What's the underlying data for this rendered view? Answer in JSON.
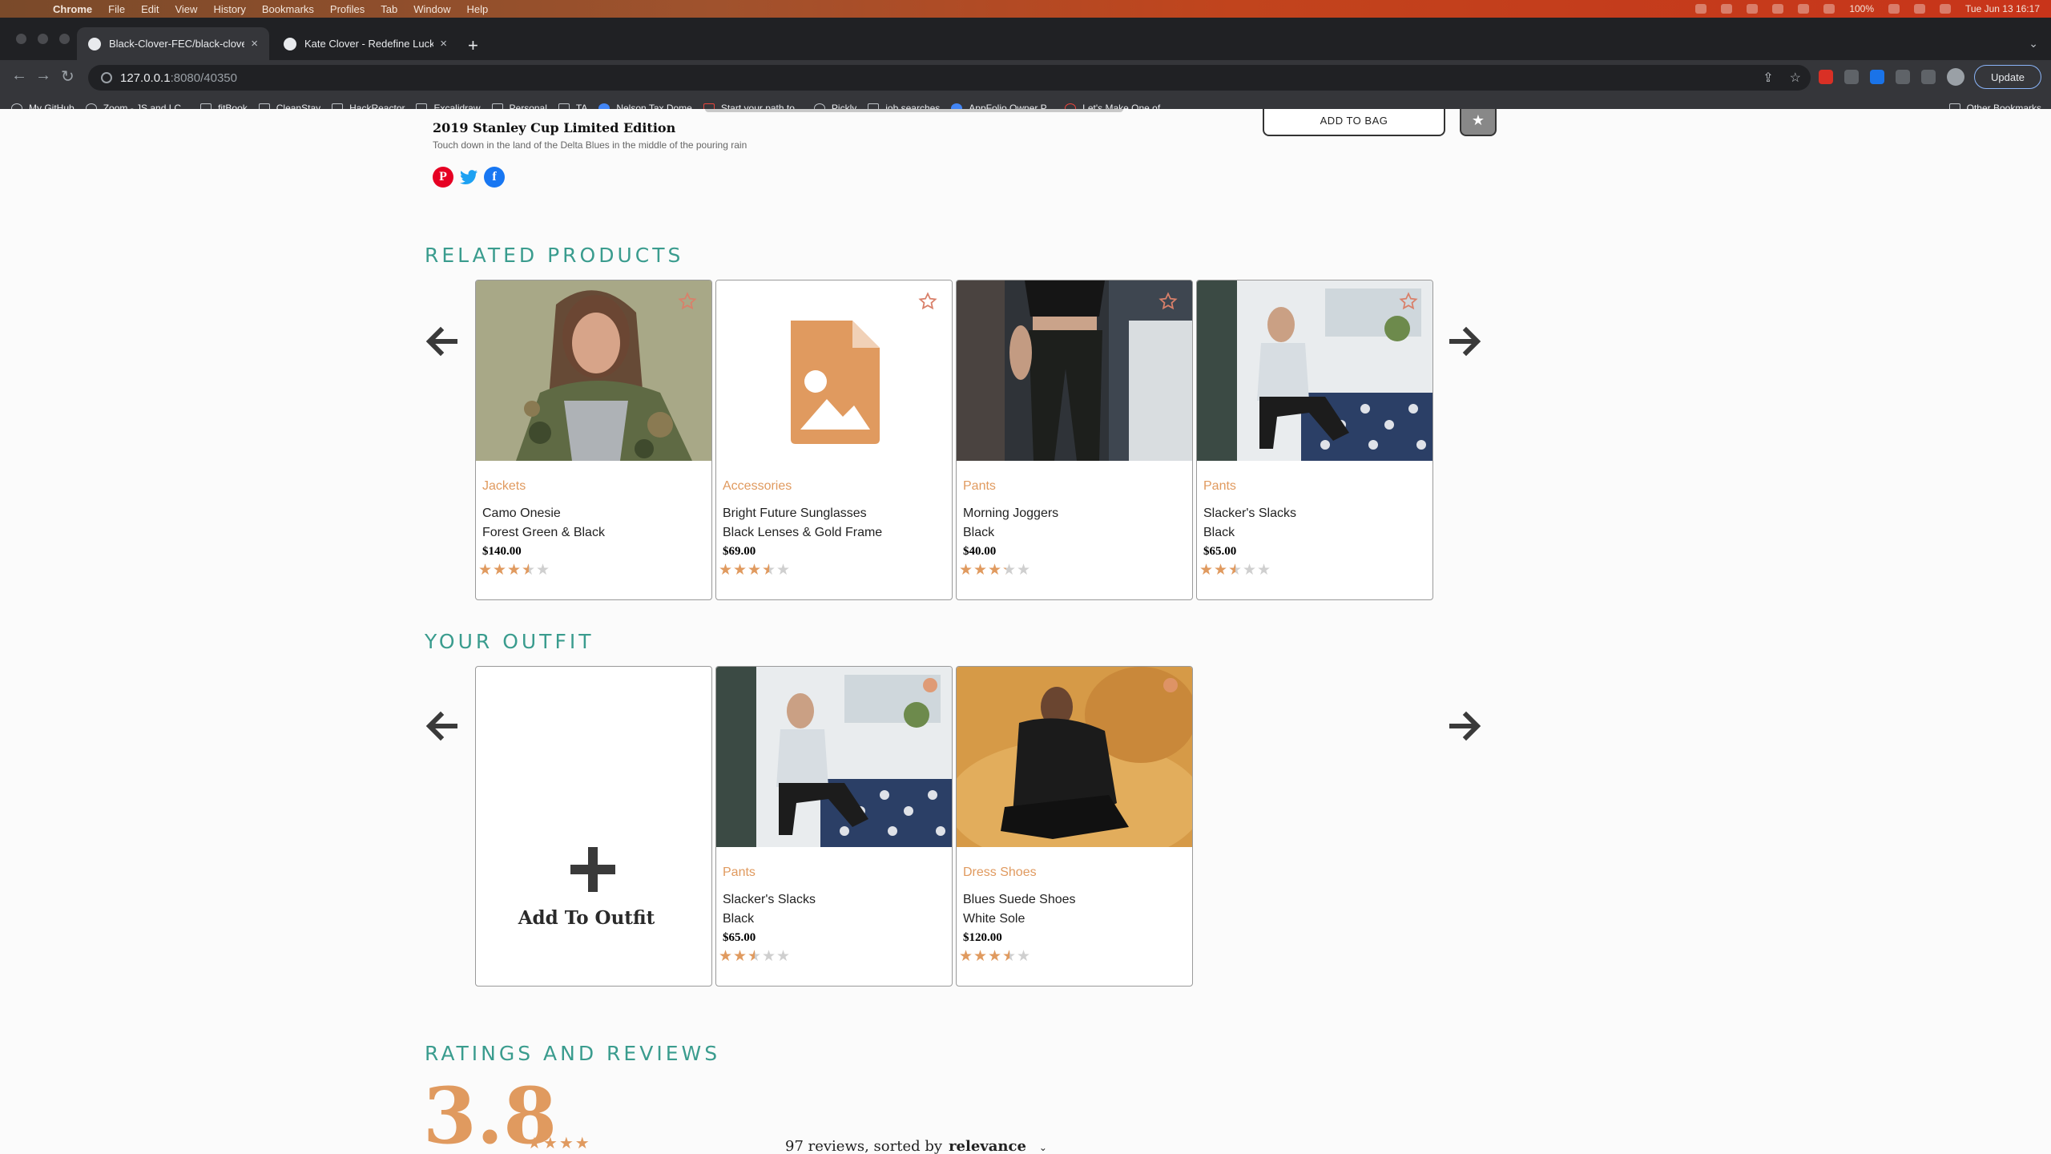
{
  "menubar": {
    "app": "Chrome",
    "items": [
      "File",
      "Edit",
      "View",
      "History",
      "Bookmarks",
      "Profiles",
      "Tab",
      "Window",
      "Help"
    ],
    "battery": "100%",
    "clock": "Tue Jun 13  16:17"
  },
  "browser": {
    "tabs": [
      {
        "title": "Black-Clover-FEC/black-clover"
      },
      {
        "title": "Kate Clover - Redefine Luck"
      }
    ],
    "url_host": "127.0.0.1",
    "url_path": ":8080/40350",
    "update_label": "Update",
    "bookmarks": [
      "My GitHub",
      "Zoom - JS and LC...",
      "fitBook",
      "CleanStay",
      "HackReactor",
      "Excalidraw",
      "Personal",
      "TA",
      "Nelson Tax Dome",
      "Start your path to...",
      "Pickly",
      "job searches",
      "AppFolio Owner P...",
      "Let's Make One of..."
    ],
    "other_bookmarks": "Other Bookmarks"
  },
  "product": {
    "title": "2019 Stanley Cup Limited Edition",
    "description": "Touch down in the land of the Delta Blues in the middle of the pouring rain",
    "add_to_bag": "ADD TO BAG",
    "social": [
      "pinterest-icon",
      "twitter-icon",
      "facebook-icon"
    ]
  },
  "related": {
    "heading": "RELATED PRODUCTS",
    "cards": [
      {
        "category": "Jackets",
        "name": "Camo Onesie",
        "style": "Forest Green & Black",
        "price": "$140.00",
        "rating": 3.5
      },
      {
        "category": "Accessories",
        "name": "Bright Future Sunglasses",
        "style": "Black Lenses & Gold Frame",
        "price": "$69.00",
        "rating": 3.5
      },
      {
        "category": "Pants",
        "name": "Morning Joggers",
        "style": "Black",
        "price": "$40.00",
        "rating": 3.25
      },
      {
        "category": "Pants",
        "name": "Slacker's Slacks",
        "style": "Black",
        "price": "$65.00",
        "rating": 2.5
      }
    ]
  },
  "outfit": {
    "heading": "YOUR OUTFIT",
    "add_label": "Add To Outfit",
    "cards": [
      {
        "category": "Pants",
        "name": "Slacker's Slacks",
        "style": "Black",
        "price": "$65.00",
        "rating": 2.5
      },
      {
        "category": "Dress Shoes",
        "name": "Blues Suede Shoes",
        "style": "White Sole",
        "price": "$120.00",
        "rating": 3.5
      }
    ]
  },
  "reviews": {
    "heading": "RATINGS AND REVIEWS",
    "average": "3.8",
    "count_text": "97 reviews, sorted by",
    "sort_value": "relevance"
  },
  "colors": {
    "accent": "#e09a5f",
    "heading_teal": "#3a9c8e"
  }
}
